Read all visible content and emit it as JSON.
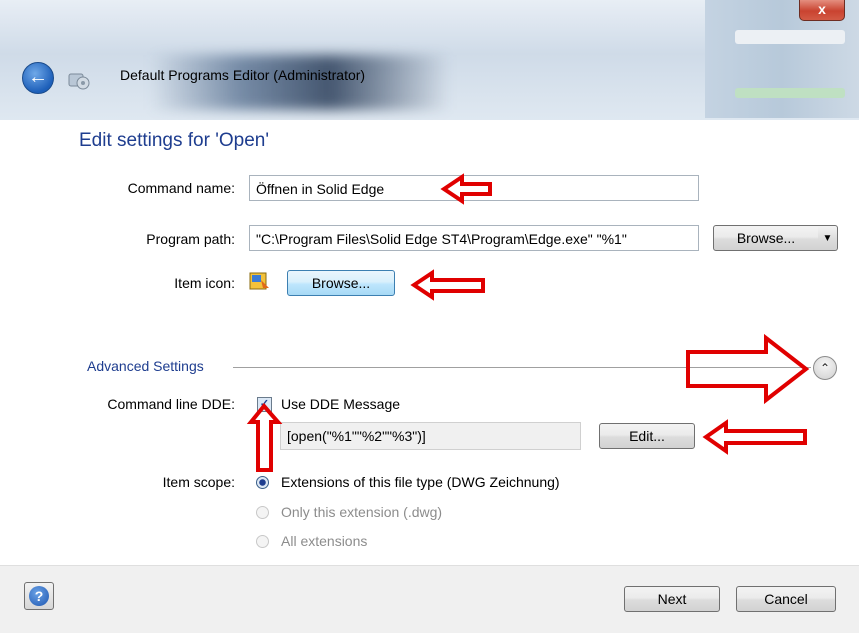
{
  "window": {
    "title": "Default Programs Editor (Administrator)",
    "close_label": "x"
  },
  "page": {
    "heading": "Edit settings for 'Open'"
  },
  "form": {
    "command_name_label": "Command name:",
    "command_name_value": "Öffnen in Solid Edge",
    "program_path_label": "Program path:",
    "program_path_value": "\"C:\\Program Files\\Solid Edge ST4\\Program\\Edge.exe\" \"%1\"",
    "browse_label": "Browse...",
    "item_icon_label": "Item icon:",
    "icon_browse_label": "Browse..."
  },
  "advanced": {
    "section_label": "Advanced Settings",
    "dde_label": "Command line DDE:",
    "use_dde_label": "Use DDE Message",
    "use_dde_checked": true,
    "dde_value": "[open(\"%1\"\"%2\"\"%3\")]",
    "edit_label": "Edit...",
    "scope_label": "Item scope:",
    "scope_options": [
      "Extensions of this file type (DWG Zeichnung)",
      "Only this extension (.dwg)",
      "All extensions"
    ],
    "scope_selected": 0
  },
  "footer": {
    "help_label": "?",
    "next_label": "Next",
    "cancel_label": "Cancel"
  },
  "icons": {
    "back": "back-arrow-icon",
    "collapse": "chevron-up-icon",
    "split": "dropdown-arrow-icon"
  },
  "colors": {
    "heading": "#1e3d8f",
    "annotation_arrows": "#e00000"
  }
}
